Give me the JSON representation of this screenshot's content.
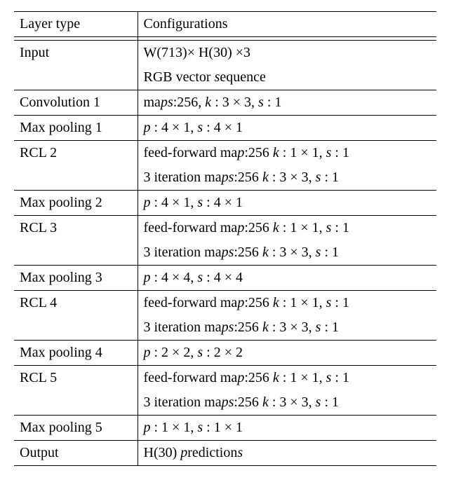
{
  "table": {
    "header": {
      "left": "Layer type",
      "right": "Configurations"
    },
    "rows": [
      {
        "left": "Input",
        "right1": "W(713)× H(30) ×3",
        "right2": "RGB vector sequence"
      },
      {
        "left": "Convolution 1",
        "right1": "maps:256, k : 3 × 3, s : 1"
      },
      {
        "left": "Max pooling 1",
        "right1": "p : 4 × 1, s : 4 × 1"
      },
      {
        "left": "RCL 2",
        "right1": "feed-forward map:256 k : 1 × 1, s : 1",
        "right2": "3 iteration maps:256 k : 3 × 3, s : 1"
      },
      {
        "left": "Max pooling 2",
        "right1": "p : 4 × 1, s : 4 × 1"
      },
      {
        "left": "RCL 3",
        "right1": "feed-forward map:256 k : 1 × 1, s : 1",
        "right2": "3 iteration maps:256 k : 3 × 3, s : 1"
      },
      {
        "left": "Max pooling 3",
        "right1": "p : 4 × 4, s : 4 × 4"
      },
      {
        "left": "RCL 4",
        "right1": "feed-forward map:256 k : 1 × 1, s : 1",
        "right2": "3 iteration maps:256 k : 3 × 3, s : 1"
      },
      {
        "left": "Max pooling 4",
        "right1": "p : 2 × 2, s : 2 × 2"
      },
      {
        "left": "RCL 5",
        "right1": "feed-forward map:256 k : 1 × 1, s : 1",
        "right2": "3 iteration maps:256 k : 3 × 3, s : 1"
      },
      {
        "left": "Max pooling 5",
        "right1": "p : 1 × 1, s : 1 × 1"
      },
      {
        "left": "Output",
        "right1": "H(30) predictions"
      }
    ]
  }
}
